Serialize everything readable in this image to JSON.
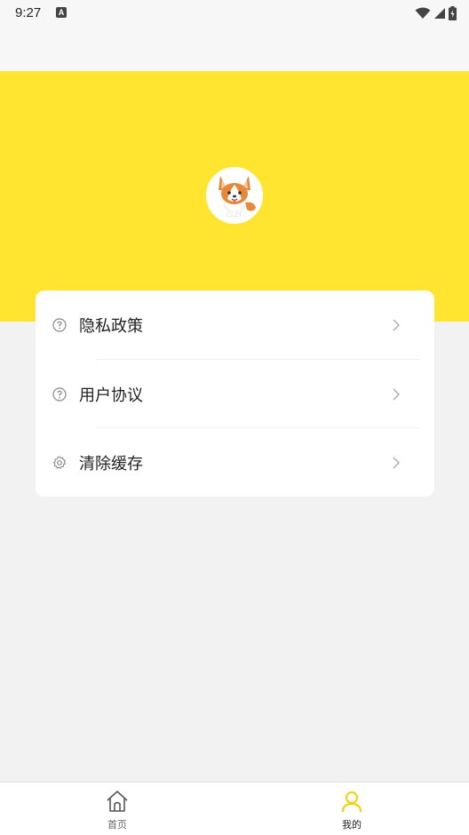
{
  "status_bar": {
    "time": "9:27",
    "notification_icon": "a-letter-icon",
    "icons": [
      "wifi-icon",
      "signal-icon",
      "battery-icon"
    ]
  },
  "profile": {
    "avatar": "corgi-avatar"
  },
  "menu": {
    "items": [
      {
        "label": "隐私政策",
        "icon": "question-circle-icon"
      },
      {
        "label": "用户协议",
        "icon": "question-circle-icon"
      },
      {
        "label": "清除缓存",
        "icon": "gear-icon"
      }
    ]
  },
  "tab_bar": {
    "tabs": [
      {
        "label": "首页",
        "icon": "home-icon",
        "active": false
      },
      {
        "label": "我的",
        "icon": "user-icon",
        "active": true
      }
    ]
  },
  "colors": {
    "accent": "#ffe430",
    "active_tab": "#f5d000",
    "inactive_tab": "#666666"
  }
}
